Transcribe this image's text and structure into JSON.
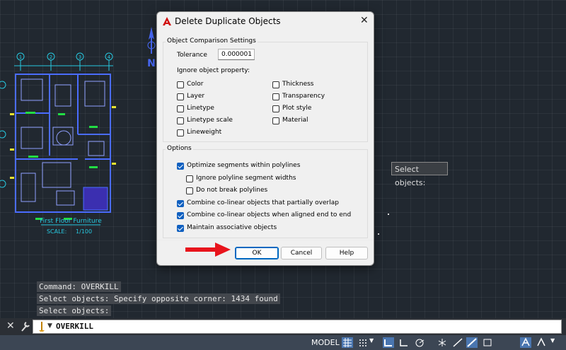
{
  "dialog": {
    "title": "Delete Duplicate Objects",
    "close_glyph": "✕",
    "comparison_group": "Object Comparison Settings",
    "tolerance_label": "Tolerance",
    "tolerance_value": "0.000001",
    "ignore_label": "Ignore object property:",
    "properties_left": [
      {
        "label": "Color",
        "checked": false
      },
      {
        "label": "Layer",
        "checked": false
      },
      {
        "label": "Linetype",
        "checked": false
      },
      {
        "label": "Linetype scale",
        "checked": false
      },
      {
        "label": "Lineweight",
        "checked": false
      }
    ],
    "properties_right": [
      {
        "label": "Thickness",
        "checked": false
      },
      {
        "label": "Transparency",
        "checked": false
      },
      {
        "label": "Plot style",
        "checked": false
      },
      {
        "label": "Material",
        "checked": false
      }
    ],
    "options_group": "Options",
    "options": [
      {
        "label": "Optimize segments within polylines",
        "checked": true,
        "indent": false
      },
      {
        "label": "Ignore polyline segment widths",
        "checked": false,
        "indent": true
      },
      {
        "label": "Do not break polylines",
        "checked": false,
        "indent": true
      },
      {
        "label": "Combine co-linear objects that partially overlap",
        "checked": true,
        "indent": false
      },
      {
        "label": "Combine co-linear objects when aligned end to end",
        "checked": true,
        "indent": false
      },
      {
        "label": "Maintain associative objects",
        "checked": true,
        "indent": false
      }
    ],
    "buttons": {
      "ok": "OK",
      "cancel": "Cancel",
      "help": "Help"
    }
  },
  "drawing": {
    "title": "First Floor Furniture",
    "scale": "SCALE:     1/100",
    "north": "N",
    "grid_labels": [
      "1",
      "2",
      "3",
      "4"
    ]
  },
  "tooltip": "Select objects:",
  "command_history": [
    "Command: OVERKILL",
    "Select objects: Specify opposite corner: 1434 found",
    "Select objects:"
  ],
  "command_line": {
    "close_glyph": "✕",
    "current": "OVERKILL"
  },
  "status_bar": {
    "model_label": "MODEL"
  },
  "colors": {
    "accent": "#0067c0",
    "arrow": "#e8141c",
    "drawing_lines": "#4a6cff",
    "drawing_green": "#22dd44",
    "drawing_text": "#27c9e0"
  }
}
